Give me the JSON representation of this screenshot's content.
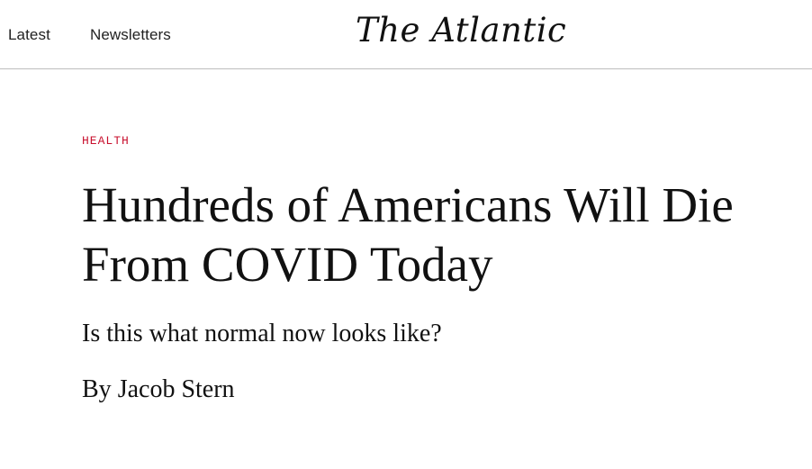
{
  "header": {
    "nav": {
      "latest_label": "Latest",
      "newsletters_label": "Newsletters"
    },
    "logo_text": "The Atlantic"
  },
  "article": {
    "section": "HEALTH",
    "headline": "Hundreds of Americans Will Die From COVID Today",
    "dek": "Is this what normal now looks like?",
    "byline": {
      "prefix": "By",
      "author": "Jacob Stern"
    }
  },
  "colors": {
    "section_accent": "#c8102e",
    "text": "#111111",
    "divider": "#bdbdbd"
  }
}
